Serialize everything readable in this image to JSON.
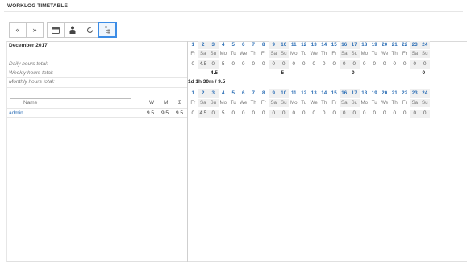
{
  "page": {
    "title": "WORKLOG TIMETABLE"
  },
  "toolbar": {
    "prev": "«",
    "next": "»",
    "buttons": [
      "calendar-icon",
      "user-icon",
      "refresh-icon",
      "tree-icon"
    ]
  },
  "summary": {
    "month": "December 2017",
    "daily_label": "Daily hours total:",
    "weekly_label": "Weekly hours total:",
    "monthly_label": "Monthly hours total:",
    "monthly_value": "1d 1h 30m / 9.5"
  },
  "days": [
    {
      "n": "1",
      "d": "Fr",
      "we": false,
      "daily": "0",
      "user": "0"
    },
    {
      "n": "2",
      "d": "Sa",
      "we": true,
      "daily": "4.5",
      "user": "4.5"
    },
    {
      "n": "3",
      "d": "Su",
      "we": true,
      "daily": "0",
      "user": "0"
    },
    {
      "n": "4",
      "d": "Mo",
      "we": false,
      "daily": "5",
      "user": "5"
    },
    {
      "n": "5",
      "d": "Tu",
      "we": false,
      "daily": "0",
      "user": "0"
    },
    {
      "n": "6",
      "d": "We",
      "we": false,
      "daily": "0",
      "user": "0"
    },
    {
      "n": "7",
      "d": "Th",
      "we": false,
      "daily": "0",
      "user": "0"
    },
    {
      "n": "8",
      "d": "Fr",
      "we": false,
      "daily": "0",
      "user": "0"
    },
    {
      "n": "9",
      "d": "Sa",
      "we": true,
      "daily": "0",
      "user": "0"
    },
    {
      "n": "10",
      "d": "Su",
      "we": true,
      "daily": "0",
      "user": "0"
    },
    {
      "n": "11",
      "d": "Mo",
      "we": false,
      "daily": "0",
      "user": "0"
    },
    {
      "n": "12",
      "d": "Tu",
      "we": false,
      "daily": "0",
      "user": "0"
    },
    {
      "n": "13",
      "d": "We",
      "we": false,
      "daily": "0",
      "user": "0"
    },
    {
      "n": "14",
      "d": "Th",
      "we": false,
      "daily": "0",
      "user": "0"
    },
    {
      "n": "15",
      "d": "Fr",
      "we": false,
      "daily": "0",
      "user": "0"
    },
    {
      "n": "16",
      "d": "Sa",
      "we": true,
      "daily": "0",
      "user": "0"
    },
    {
      "n": "17",
      "d": "Su",
      "we": true,
      "daily": "0",
      "user": "0"
    },
    {
      "n": "18",
      "d": "Mo",
      "we": false,
      "daily": "0",
      "user": "0"
    },
    {
      "n": "19",
      "d": "Tu",
      "we": false,
      "daily": "0",
      "user": "0"
    },
    {
      "n": "20",
      "d": "We",
      "we": false,
      "daily": "0",
      "user": "0"
    },
    {
      "n": "21",
      "d": "Th",
      "we": false,
      "daily": "0",
      "user": "0"
    },
    {
      "n": "22",
      "d": "Fr",
      "we": false,
      "daily": "0",
      "user": "0"
    },
    {
      "n": "23",
      "d": "Sa",
      "we": true,
      "daily": "0",
      "user": "0"
    },
    {
      "n": "24",
      "d": "Su",
      "we": true,
      "daily": "0",
      "user": "0"
    }
  ],
  "weekly": [
    {
      "day_index": 2,
      "value": "4.5"
    },
    {
      "day_index": 9,
      "value": "5"
    },
    {
      "day_index": 16,
      "value": "0"
    },
    {
      "day_index": 23,
      "value": "0"
    }
  ],
  "table": {
    "name_placeholder": "Name",
    "columns": [
      "W",
      "M",
      "Σ"
    ],
    "rows": [
      {
        "name": "admin",
        "w": "9.5",
        "m": "9.5",
        "sum": "9.5"
      }
    ]
  }
}
